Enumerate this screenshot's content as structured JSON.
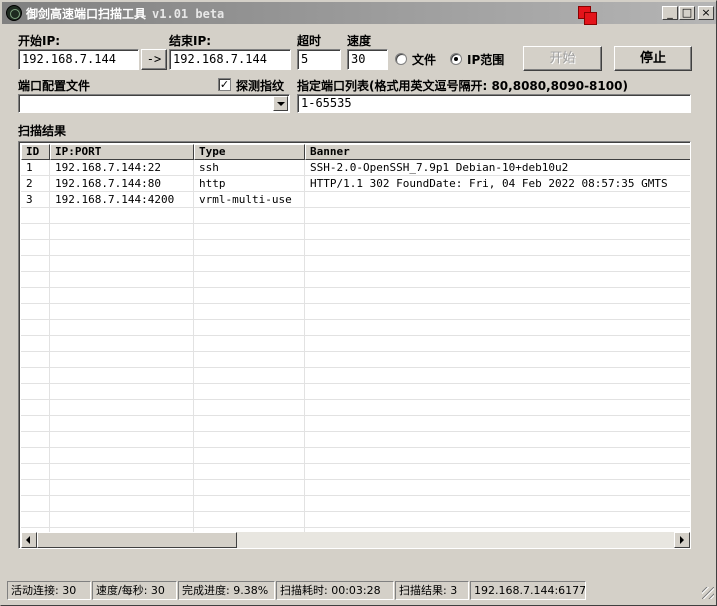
{
  "window": {
    "title": "御剑高速端口扫描工具",
    "version": "v1.01 beta",
    "minimize": "_",
    "maximize": "□",
    "close": "×"
  },
  "form": {
    "start_ip_label": "开始IP:",
    "start_ip_value": "192.168.7.144",
    "arrow_button": "->",
    "end_ip_label": "结束IP:",
    "end_ip_value": "192.168.7.144",
    "timeout_label": "超时",
    "timeout_value": "5",
    "speed_label": "速度",
    "speed_value": "30",
    "radio_file_label": "文件",
    "radio_iprange_label": "IP范围",
    "selected_mode": "IP范围",
    "start_button": "开始",
    "stop_button": "停止",
    "port_config_label": "端口配置文件",
    "port_config_value": "",
    "detect_fingerprint_label": "探测指纹",
    "detect_fingerprint_checked": true,
    "port_list_label": "指定端口列表(格式用英文逗号隔开: 80,8080,8090-8100)",
    "port_list_value": "1-65535"
  },
  "results": {
    "section_label": "扫描结果",
    "columns": [
      "ID",
      "IP:PORT",
      "Type",
      "Banner"
    ],
    "rows": [
      {
        "id": "1",
        "ipport": "192.168.7.144:22",
        "type": "ssh",
        "banner": "SSH-2.0-OpenSSH_7.9p1 Debian-10+deb10u2"
      },
      {
        "id": "2",
        "ipport": "192.168.7.144:80",
        "type": "http",
        "banner": "HTTP/1.1 302 FoundDate: Fri, 04 Feb 2022 08:57:35 GMTS"
      },
      {
        "id": "3",
        "ipport": "192.168.7.144:4200",
        "type": "vrml-multi-use",
        "banner": ""
      }
    ]
  },
  "status": {
    "active_connections": "活动连接: 30",
    "speed_per_sec": "速度/每秒: 30",
    "progress": "完成进度: 9.38%",
    "elapsed": "扫描耗时: 00:03:28",
    "result_count": "扫描结果: 3",
    "current_target": "192.168.7.144:6177"
  },
  "colors": {
    "titlebar_start": "#808080",
    "titlebar_end": "#b5b5b5",
    "face": "#d4d0c8",
    "tray_icon": "#e4141b"
  }
}
